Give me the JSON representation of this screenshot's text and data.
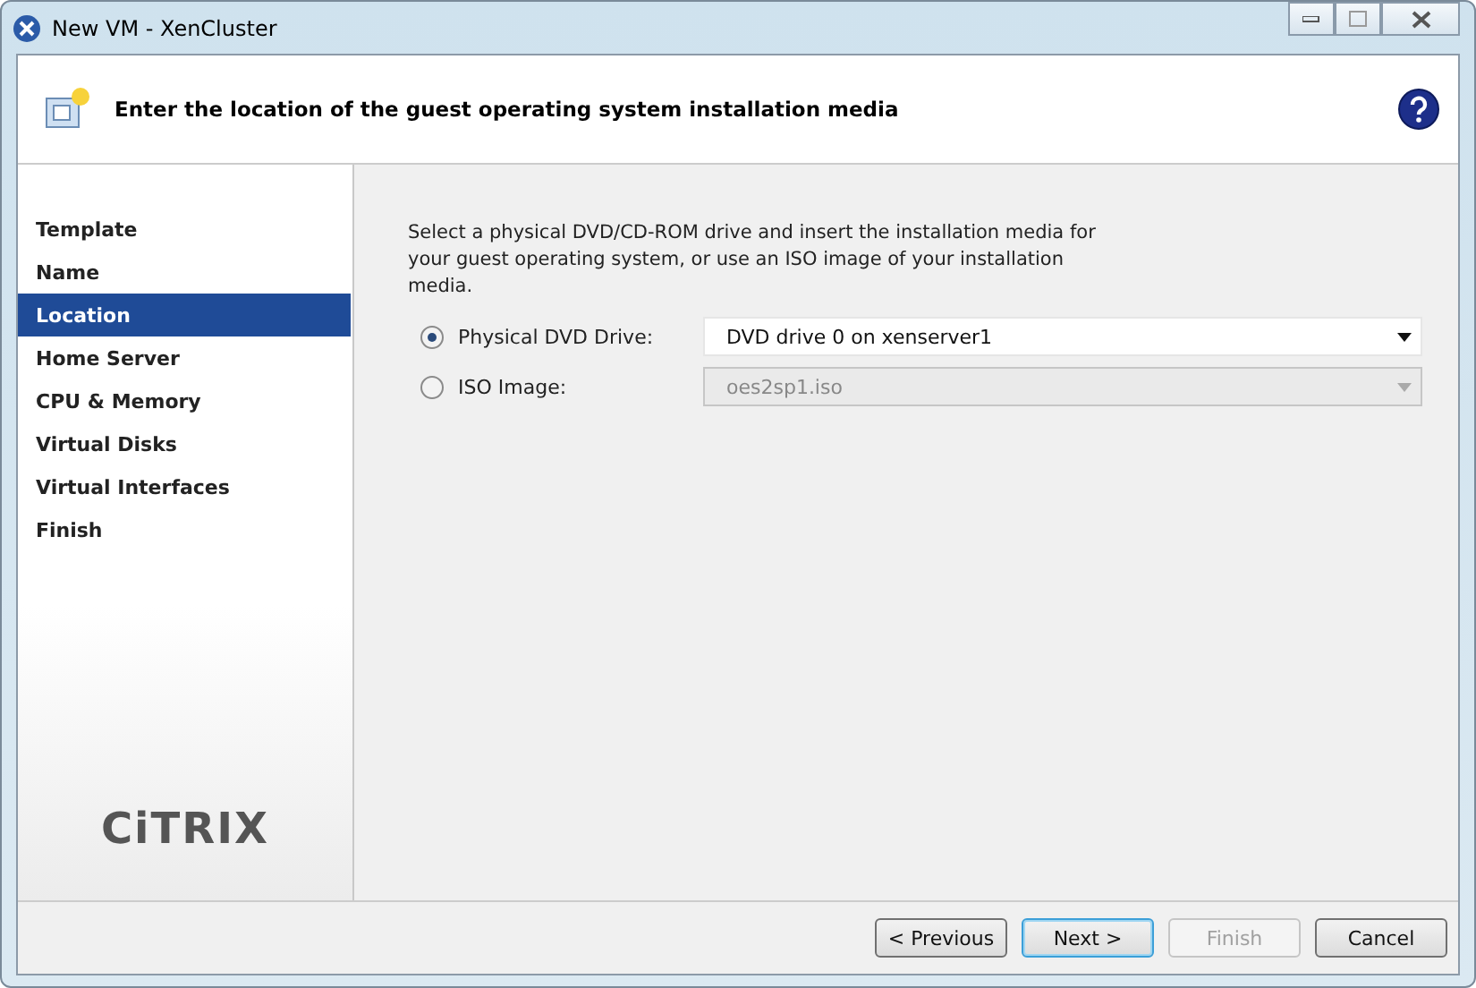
{
  "window": {
    "title": "New VM - XenCluster"
  },
  "header": {
    "title": "Enter the location of the guest operating system installation media"
  },
  "sidebar": {
    "items": [
      {
        "label": "Template",
        "selected": false
      },
      {
        "label": "Name",
        "selected": false
      },
      {
        "label": "Location",
        "selected": true
      },
      {
        "label": "Home Server",
        "selected": false
      },
      {
        "label": "CPU & Memory",
        "selected": false
      },
      {
        "label": "Virtual Disks",
        "selected": false
      },
      {
        "label": "Virtual Interfaces",
        "selected": false
      },
      {
        "label": "Finish",
        "selected": false
      }
    ],
    "logo": "CiTRIX"
  },
  "content": {
    "description": "Select a physical DVD/CD-ROM drive and insert the installation media for your guest operating system, or use an ISO image of your installation media.",
    "options": [
      {
        "label": "Physical DVD Drive:",
        "selected": true,
        "value": "DVD drive 0 on xenserver1",
        "disabled": false
      },
      {
        "label": "ISO Image:",
        "selected": false,
        "value": "oes2sp1.iso",
        "disabled": true
      }
    ]
  },
  "buttons": [
    {
      "label": "< Previous",
      "disabled": false,
      "focused": false
    },
    {
      "label": "Next >",
      "disabled": false,
      "focused": true
    },
    {
      "label": "Finish",
      "disabled": true,
      "focused": false
    },
    {
      "label": "Cancel",
      "disabled": false,
      "focused": false
    }
  ]
}
